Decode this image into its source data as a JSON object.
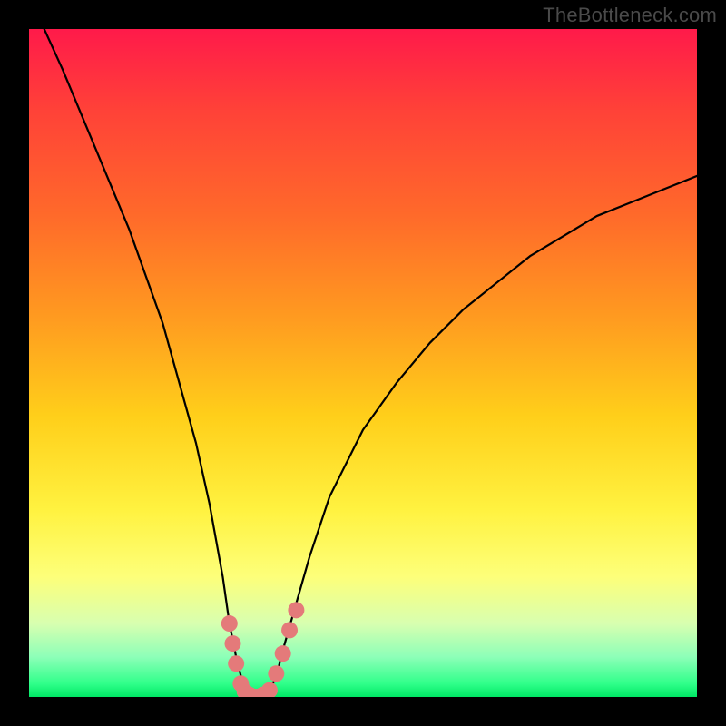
{
  "watermark": "TheBottleneck.com",
  "chart_data": {
    "type": "line",
    "title": "",
    "xlabel": "",
    "ylabel": "",
    "xlim": [
      0,
      100
    ],
    "ylim": [
      0,
      100
    ],
    "x": [
      0,
      5,
      10,
      15,
      20,
      25,
      27,
      29,
      30,
      31,
      32,
      33,
      34,
      35,
      36,
      37,
      38,
      40,
      42,
      45,
      50,
      55,
      60,
      65,
      70,
      75,
      80,
      85,
      90,
      95,
      100
    ],
    "values": [
      105,
      94,
      82,
      70,
      56,
      38,
      29,
      18,
      11,
      6,
      2,
      0,
      0,
      0,
      1,
      3,
      7,
      14,
      21,
      30,
      40,
      47,
      53,
      58,
      62,
      66,
      69,
      72,
      74,
      76,
      78
    ],
    "marker_points": [
      {
        "x": 30.0,
        "y": 11.0
      },
      {
        "x": 30.5,
        "y": 8.0
      },
      {
        "x": 31.0,
        "y": 5.0
      },
      {
        "x": 31.7,
        "y": 2.0
      },
      {
        "x": 32.3,
        "y": 0.8
      },
      {
        "x": 33.0,
        "y": 0.3
      },
      {
        "x": 34.0,
        "y": 0.0
      },
      {
        "x": 35.0,
        "y": 0.3
      },
      {
        "x": 36.0,
        "y": 1.0
      },
      {
        "x": 37.0,
        "y": 3.5
      },
      {
        "x": 38.0,
        "y": 6.5
      },
      {
        "x": 39.0,
        "y": 10.0
      },
      {
        "x": 40.0,
        "y": 13.0
      }
    ],
    "marker_color": "#e47a7a",
    "curve_color": "#000000",
    "curve_width": 2.2
  }
}
